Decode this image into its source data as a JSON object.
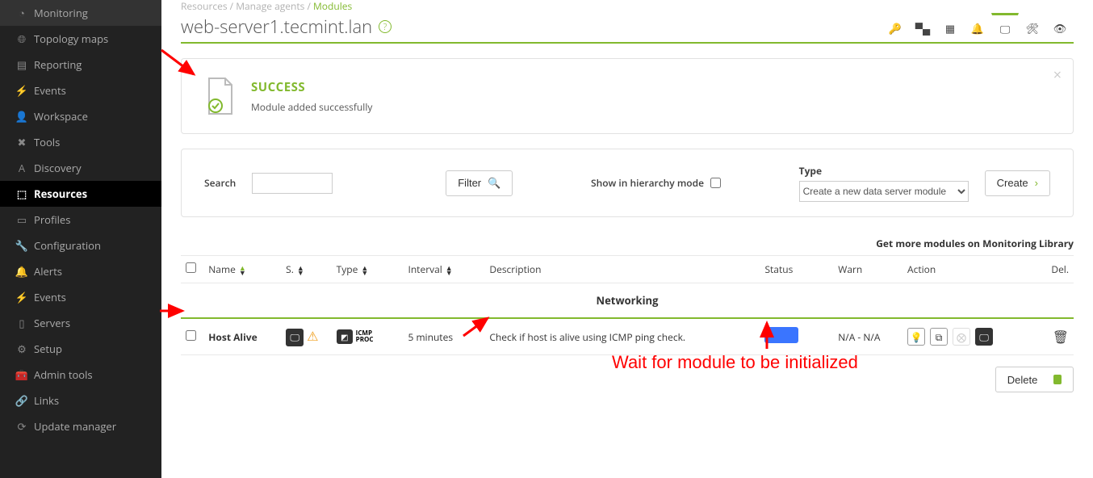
{
  "breadcrumb": {
    "a": "Resources",
    "b": "Manage agents",
    "c": "Modules"
  },
  "page_title": "web-server1.tecmint.lan",
  "sidebar": [
    {
      "icon": "gauge",
      "label": "Monitoring"
    },
    {
      "icon": "globe",
      "label": "Topology maps"
    },
    {
      "icon": "report",
      "label": "Reporting"
    },
    {
      "icon": "bolt",
      "label": "Events"
    },
    {
      "icon": "user",
      "label": "Workspace"
    },
    {
      "icon": "wrenchx",
      "label": "Tools"
    },
    {
      "icon": "A",
      "label": "Discovery"
    },
    {
      "icon": "box",
      "label": "Resources",
      "active": true
    },
    {
      "icon": "id",
      "label": "Profiles"
    },
    {
      "icon": "wrench",
      "label": "Configuration"
    },
    {
      "icon": "bell",
      "label": "Alerts"
    },
    {
      "icon": "bolt",
      "label": "Events"
    },
    {
      "icon": "server",
      "label": "Servers"
    },
    {
      "icon": "gear",
      "label": "Setup"
    },
    {
      "icon": "toolbox",
      "label": "Admin tools"
    },
    {
      "icon": "link",
      "label": "Links"
    },
    {
      "icon": "refresh",
      "label": "Update manager"
    }
  ],
  "success": {
    "title": "SUCCESS",
    "msg": "Module added successfully"
  },
  "filter": {
    "search_label": "Search",
    "filter_btn": "Filter",
    "hierarchy_label": "Show in hierarchy mode",
    "type_label": "Type",
    "type_option": "Create a new data server module",
    "create_btn": "Create"
  },
  "link": "Get more modules on Monitoring Library",
  "headers": {
    "name": "Name",
    "s": "S.",
    "type": "Type",
    "interval": "Interval",
    "desc": "Description",
    "status": "Status",
    "warn": "Warn",
    "action": "Action",
    "del": "Del."
  },
  "group": "Networking",
  "row": {
    "name": "Host Alive",
    "interval": "5 minutes",
    "desc": "Check if host is alive using ICMP ping check.",
    "warn": "N/A - N/A"
  },
  "delete_btn": "Delete",
  "annotation": "Wait for module to be initialized"
}
